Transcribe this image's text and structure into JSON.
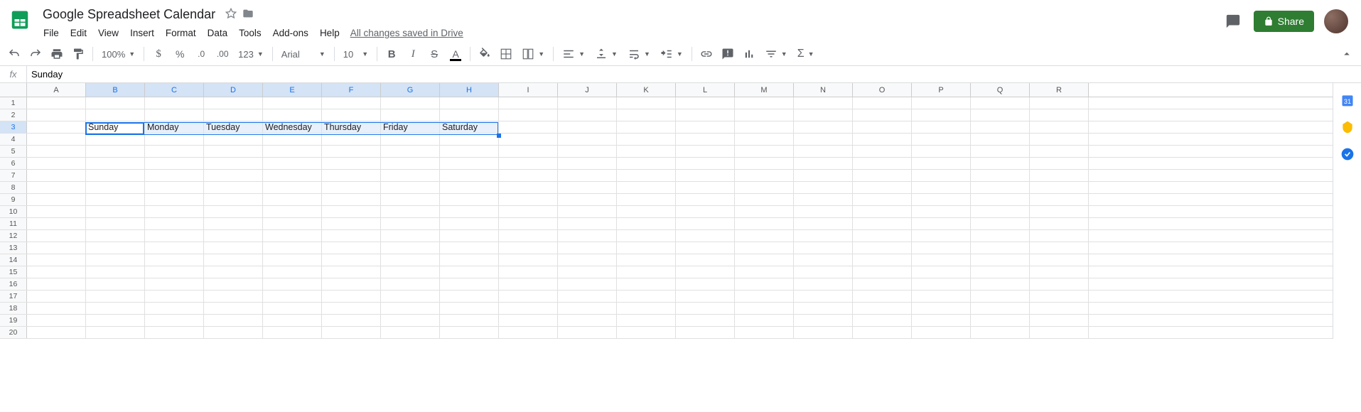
{
  "header": {
    "doc_title": "Google Spreadsheet Calendar",
    "save_status": "All changes saved in Drive",
    "share_label": "Share"
  },
  "menubar": {
    "items": [
      "File",
      "Edit",
      "View",
      "Insert",
      "Format",
      "Data",
      "Tools",
      "Add-ons",
      "Help"
    ]
  },
  "toolbar": {
    "zoom": "100%",
    "currency_fmt": "123",
    "font": "Arial",
    "font_size": "10"
  },
  "formula_bar": {
    "fx_label": "fx",
    "value": "Sunday"
  },
  "grid": {
    "columns": [
      "A",
      "B",
      "C",
      "D",
      "E",
      "F",
      "G",
      "H",
      "I",
      "J",
      "K",
      "L",
      "M",
      "N",
      "O",
      "P",
      "Q",
      "R"
    ],
    "selected_columns": [
      "B",
      "C",
      "D",
      "E",
      "F",
      "G",
      "H"
    ],
    "row_count": 20,
    "selected_row": 3,
    "active_cell": "B3",
    "active_cell_col": "B",
    "active_cell_row": 3,
    "cells": {
      "B3": "Sunday",
      "C3": "Monday",
      "D3": "Tuesday",
      "E3": "Wednesday",
      "F3": "Thursday",
      "G3": "Friday",
      "H3": "Saturday"
    },
    "selection_range": {
      "start_col": "B",
      "end_col": "H",
      "row": 3
    }
  }
}
